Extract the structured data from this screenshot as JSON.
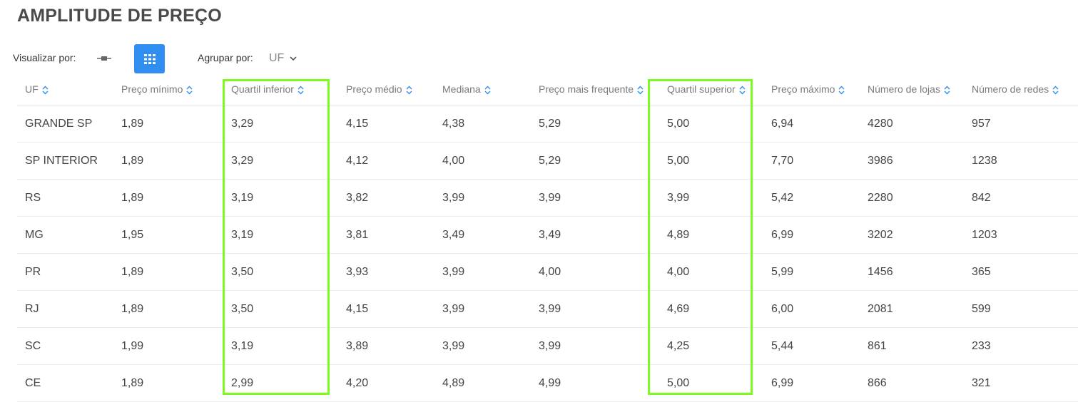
{
  "page": {
    "title": "AMPLITUDE DE PREÇO"
  },
  "controls": {
    "view_label": "Visualizar por:",
    "view_options": [
      "chart-view-icon",
      "grid-view-icon"
    ],
    "view_active": "grid-view-icon",
    "group_label": "Agrupar por:",
    "group_value": "UF"
  },
  "table": {
    "columns": [
      "UF",
      "Preço mínimo",
      "Quartil inferior",
      "Preço médio",
      "Mediana",
      "Preço mais frequente",
      "Quartil superior",
      "Preço máximo",
      "Número de lojas",
      "Número de redes"
    ],
    "rows": [
      [
        "GRANDE SP",
        "1,89",
        "3,29",
        "4,15",
        "4,38",
        "5,29",
        "5,00",
        "6,94",
        "4280",
        "957"
      ],
      [
        "SP INTERIOR",
        "1,89",
        "3,29",
        "4,12",
        "4,00",
        "5,29",
        "5,00",
        "7,70",
        "3986",
        "1238"
      ],
      [
        "RS",
        "1,89",
        "3,19",
        "3,82",
        "3,99",
        "3,99",
        "3,99",
        "5,42",
        "2280",
        "842"
      ],
      [
        "MG",
        "1,95",
        "3,19",
        "3,81",
        "3,49",
        "3,49",
        "4,89",
        "6,99",
        "3202",
        "1203"
      ],
      [
        "PR",
        "1,89",
        "3,50",
        "3,93",
        "3,99",
        "4,00",
        "4,00",
        "5,99",
        "1456",
        "365"
      ],
      [
        "RJ",
        "1,89",
        "3,50",
        "4,15",
        "3,99",
        "3,99",
        "4,69",
        "6,00",
        "2081",
        "599"
      ],
      [
        "SC",
        "1,99",
        "3,19",
        "3,89",
        "3,99",
        "3,99",
        "4,25",
        "5,44",
        "861",
        "233"
      ],
      [
        "CE",
        "1,89",
        "2,99",
        "4,20",
        "4,89",
        "4,99",
        "5,00",
        "6,99",
        "866",
        "321"
      ]
    ],
    "highlighted_columns": [
      "Quartil inferior",
      "Quartil superior"
    ]
  },
  "colors": {
    "accent": "#2f8ef0",
    "highlight": "#7cfc1e",
    "sort_icon": "#2f8ef0"
  }
}
